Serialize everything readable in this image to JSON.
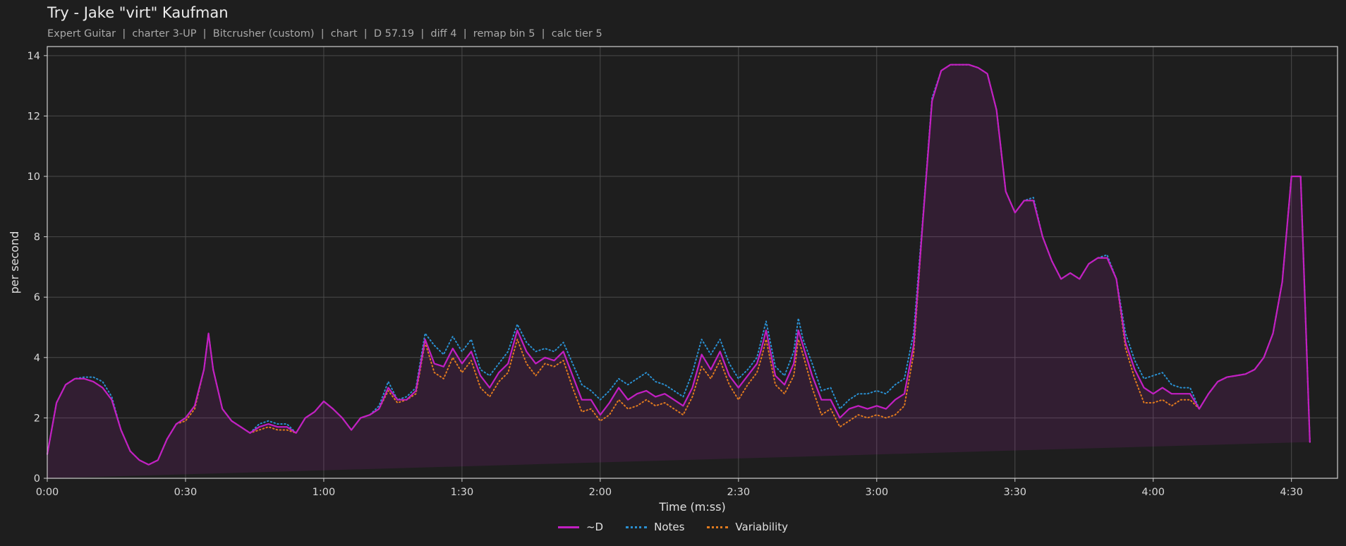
{
  "header": {
    "title": "Try - Jake \"virt\" Kaufman",
    "subtitle": "Expert Guitar  |  charter 3-UP  |  Bitcrusher (custom)  |  chart  |  D 57.19  |  diff 4  |  remap bin 5  |  calc tier 5"
  },
  "chart_data": {
    "type": "line",
    "xlabel": "Time (m:ss)",
    "ylabel": "per second",
    "xlim": [
      0,
      280
    ],
    "ylim": [
      0,
      14.3
    ],
    "x_ticks": [
      {
        "value": 0,
        "label": "0:00"
      },
      {
        "value": 30,
        "label": "0:30"
      },
      {
        "value": 60,
        "label": "1:00"
      },
      {
        "value": 90,
        "label": "1:30"
      },
      {
        "value": 120,
        "label": "2:00"
      },
      {
        "value": 150,
        "label": "2:30"
      },
      {
        "value": 180,
        "label": "3:00"
      },
      {
        "value": 210,
        "label": "3:30"
      },
      {
        "value": 240,
        "label": "4:00"
      },
      {
        "value": 270,
        "label": "4:30"
      }
    ],
    "y_ticks": [
      0,
      2,
      4,
      6,
      8,
      10,
      12,
      14
    ],
    "grid": true,
    "legend_position": "bottom-center",
    "x": [
      0,
      2,
      4,
      6,
      8,
      10,
      12,
      14,
      16,
      18,
      20,
      22,
      24,
      26,
      28,
      30,
      32,
      34,
      35,
      36,
      38,
      40,
      42,
      44,
      46,
      48,
      50,
      52,
      54,
      56,
      58,
      60,
      62,
      64,
      66,
      68,
      70,
      72,
      74,
      76,
      78,
      80,
      82,
      84,
      86,
      88,
      90,
      92,
      94,
      96,
      98,
      100,
      102,
      104,
      106,
      108,
      110,
      112,
      114,
      116,
      118,
      120,
      122,
      124,
      126,
      128,
      130,
      132,
      134,
      136,
      138,
      140,
      142,
      144,
      146,
      148,
      150,
      152,
      154,
      155,
      156,
      158,
      160,
      162,
      163,
      164,
      166,
      168,
      170,
      172,
      174,
      176,
      178,
      180,
      182,
      184,
      186,
      188,
      190,
      192,
      194,
      196,
      198,
      200,
      202,
      204,
      206,
      208,
      210,
      212,
      214,
      216,
      218,
      220,
      222,
      224,
      226,
      228,
      230,
      232,
      234,
      236,
      238,
      240,
      242,
      244,
      246,
      248,
      250,
      252,
      254,
      256,
      258,
      260,
      262,
      264,
      266,
      268,
      270,
      272,
      274,
      276,
      278,
      280
    ],
    "series": [
      {
        "name": "~D",
        "color": "#c21fc2",
        "dash": "solid",
        "values": [
          0.8,
          2.5,
          3.1,
          3.3,
          3.3,
          3.2,
          3.0,
          2.6,
          1.6,
          0.9,
          0.6,
          0.45,
          0.6,
          1.3,
          1.8,
          2.0,
          2.4,
          3.6,
          4.8,
          3.6,
          2.3,
          1.9,
          1.7,
          1.5,
          1.7,
          1.8,
          1.7,
          1.7,
          1.5,
          2.0,
          2.2,
          2.55,
          2.3,
          2.0,
          1.6,
          2.0,
          2.1,
          2.3,
          3.0,
          2.6,
          2.6,
          2.9,
          4.6,
          3.8,
          3.7,
          4.3,
          3.8,
          4.2,
          3.4,
          3.0,
          3.5,
          3.8,
          4.9,
          4.2,
          3.8,
          4.0,
          3.9,
          4.2,
          3.4,
          2.6,
          2.6,
          2.1,
          2.5,
          3.0,
          2.6,
          2.8,
          2.9,
          2.7,
          2.8,
          2.6,
          2.4,
          3.0,
          4.1,
          3.6,
          4.2,
          3.4,
          3.0,
          3.4,
          3.8,
          4.3,
          4.9,
          3.4,
          3.1,
          3.8,
          4.9,
          4.4,
          3.4,
          2.6,
          2.6,
          2.0,
          2.3,
          2.4,
          2.3,
          2.4,
          2.3,
          2.6,
          2.8,
          4.4,
          8.5,
          12.5,
          13.5,
          13.7,
          13.7,
          13.7,
          13.6,
          13.4,
          12.2,
          9.5,
          8.8,
          9.2,
          9.2,
          8.0,
          7.2,
          6.6,
          6.8,
          6.6,
          7.1,
          7.3,
          7.3,
          6.6,
          4.5,
          3.6,
          3.0,
          2.8,
          3.0,
          2.8,
          2.8,
          2.8,
          2.3,
          2.8,
          3.2,
          3.35,
          3.4,
          3.45,
          3.6,
          4.0,
          4.8,
          6.5,
          10.0,
          10.0,
          1.2
        ]
      },
      {
        "name": "Notes",
        "color": "#2a8fd0",
        "dash": "dotted",
        "values": [
          0.8,
          2.5,
          3.1,
          3.3,
          3.35,
          3.35,
          3.2,
          2.7,
          1.6,
          0.9,
          0.6,
          0.45,
          0.6,
          1.3,
          1.8,
          2.0,
          2.4,
          3.6,
          4.8,
          3.6,
          2.3,
          1.9,
          1.7,
          1.5,
          1.8,
          1.9,
          1.8,
          1.8,
          1.5,
          2.0,
          2.2,
          2.55,
          2.3,
          2.0,
          1.6,
          2.0,
          2.1,
          2.4,
          3.2,
          2.6,
          2.7,
          3.0,
          4.8,
          4.4,
          4.1,
          4.7,
          4.2,
          4.6,
          3.6,
          3.4,
          3.8,
          4.2,
          5.1,
          4.5,
          4.2,
          4.3,
          4.2,
          4.5,
          3.8,
          3.1,
          2.9,
          2.6,
          2.9,
          3.3,
          3.1,
          3.3,
          3.5,
          3.2,
          3.1,
          2.9,
          2.7,
          3.5,
          4.6,
          4.1,
          4.6,
          3.8,
          3.3,
          3.6,
          4.0,
          4.6,
          5.2,
          3.7,
          3.4,
          4.2,
          5.3,
          4.6,
          3.8,
          2.9,
          3.0,
          2.3,
          2.6,
          2.8,
          2.8,
          2.9,
          2.8,
          3.1,
          3.3,
          4.8,
          8.6,
          12.6,
          13.5,
          13.7,
          13.7,
          13.7,
          13.6,
          13.4,
          12.2,
          9.5,
          8.8,
          9.2,
          9.3,
          8.0,
          7.2,
          6.6,
          6.8,
          6.6,
          7.1,
          7.3,
          7.4,
          6.6,
          4.8,
          3.9,
          3.3,
          3.4,
          3.5,
          3.1,
          3.0,
          3.0,
          2.3,
          2.8,
          3.2,
          3.35,
          3.4,
          3.45,
          3.6,
          4.0,
          4.8,
          6.5,
          10.0,
          10.0,
          1.2
        ]
      },
      {
        "name": "Variability",
        "color": "#e07a1e",
        "dash": "dotted",
        "values": [
          0.8,
          2.5,
          3.1,
          3.3,
          3.3,
          3.2,
          3.0,
          2.6,
          1.6,
          0.9,
          0.6,
          0.45,
          0.6,
          1.3,
          1.8,
          1.9,
          2.3,
          3.6,
          4.8,
          3.6,
          2.3,
          1.9,
          1.7,
          1.5,
          1.6,
          1.7,
          1.6,
          1.6,
          1.5,
          2.0,
          2.2,
          2.55,
          2.3,
          2.0,
          1.6,
          2.0,
          2.1,
          2.3,
          2.9,
          2.5,
          2.6,
          2.8,
          4.5,
          3.5,
          3.3,
          4.0,
          3.5,
          3.9,
          3.0,
          2.7,
          3.2,
          3.5,
          4.6,
          3.8,
          3.4,
          3.8,
          3.7,
          3.9,
          3.0,
          2.2,
          2.3,
          1.9,
          2.1,
          2.6,
          2.3,
          2.4,
          2.6,
          2.4,
          2.5,
          2.3,
          2.1,
          2.7,
          3.7,
          3.3,
          3.9,
          3.1,
          2.6,
          3.1,
          3.5,
          4.0,
          4.6,
          3.1,
          2.8,
          3.4,
          4.6,
          4.1,
          3.0,
          2.1,
          2.3,
          1.7,
          1.9,
          2.1,
          2.0,
          2.1,
          2.0,
          2.1,
          2.4,
          4.1,
          8.5,
          12.5,
          13.5,
          13.7,
          13.7,
          13.7,
          13.6,
          13.4,
          12.2,
          9.5,
          8.8,
          9.2,
          9.2,
          8.0,
          7.2,
          6.6,
          6.8,
          6.6,
          7.1,
          7.3,
          7.3,
          6.6,
          4.3,
          3.3,
          2.5,
          2.5,
          2.6,
          2.4,
          2.6,
          2.6,
          2.3,
          2.8,
          3.2,
          3.35,
          3.4,
          3.45,
          3.6,
          4.0,
          4.8,
          6.5,
          10.0,
          10.0,
          1.2
        ]
      }
    ]
  }
}
